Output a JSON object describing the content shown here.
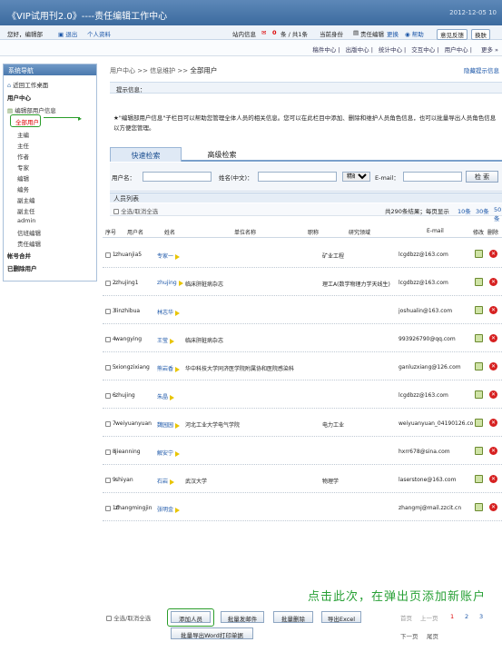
{
  "app": {
    "title": "《VIP试用刊2.0》----责任编辑工作中心",
    "date": "2012-12-05 10"
  },
  "userbar": {
    "greeting": "您好，编辑部",
    "logout": "退出",
    "profile": "个人资料",
    "messages_prefix": "站内信息",
    "messages_count": "0",
    "messages_unit": "条 / 共1条",
    "role_label": "当前身份",
    "role": "责任编辑",
    "change": "更换",
    "help": "帮助",
    "feedback": "意见反馈",
    "switch": "换肤"
  },
  "nav": {
    "items": [
      "稿件中心",
      "出版中心",
      "统计中心",
      "交互中心",
      "用户中心",
      "更多"
    ]
  },
  "sidebar": {
    "header": "系统导航",
    "desktop": "近回工作桌面",
    "user_center": "用户中心",
    "edit_dept_info": "编辑部用户信息",
    "all_users": "全部用户",
    "items": [
      "主编",
      "主任",
      "作者",
      "专家",
      "编辑",
      "编务",
      "副主编",
      "副主任",
      "admin",
      "信班编辑",
      "责任编辑"
    ],
    "account_merge": "帐号合并",
    "deleted_users": "已删除用户"
  },
  "main": {
    "breadcrumb_prefix": "用户中心 >> 信息维护 >> ",
    "breadcrumb_current": "全部用户",
    "hide_tips": "隐藏提示信息",
    "prompt": "提示信息：",
    "help_text": "★\"编辑部用户信息\"子栏目可以帮助您管理全体人员的相关信息。您可以在此栏目中添加、删除和维护人员角色信息，也可以批量导出人员角色信息以方便您管理。"
  },
  "tabs": {
    "quick": "快速检索",
    "advanced": "高级检索"
  },
  "search": {
    "user_label": "用户名：",
    "name_label": "姓名(中文)：",
    "match": "精确",
    "email_label": "E-mail：",
    "button": "检 索"
  },
  "list": {
    "header": "人员列表",
    "select_all": "全选/取消全选",
    "summary_prefix": "共290条结果；每页显示",
    "per_page": [
      "10条",
      "30条",
      "50条"
    ]
  },
  "table": {
    "columns": [
      "序号",
      "用户名",
      "姓名",
      "单位名称",
      "职称",
      "研究领域",
      "E-mail",
      "修改",
      "删除"
    ],
    "rows": [
      {
        "no": "1",
        "user": "zhuanjia5",
        "name": "专家一",
        "unit": "",
        "title": "",
        "field": "矿业工程",
        "email": "lcgdbzz@163.com"
      },
      {
        "no": "2",
        "user": "zhujing1",
        "name": "zhujing",
        "unit": "临床肝脏病杂志",
        "title": "",
        "field": "理工A(数学物理力学天线生)",
        "email": "lcgdbzz@163.com"
      },
      {
        "no": "3",
        "user": "linzhibua",
        "name": "林志华",
        "unit": "",
        "title": "",
        "field": "",
        "email": "joshualin@163.com"
      },
      {
        "no": "4",
        "user": "wangying",
        "name": "王莹",
        "unit": "临床肝脏病杂志",
        "title": "",
        "field": "",
        "email": "993926790@qq.com"
      },
      {
        "no": "5",
        "user": "xiongzixiang",
        "name": "熊岩香",
        "unit": "华中科技大学同济医学院附属协和医院感染科",
        "title": "",
        "field": "",
        "email": "ganluzxiang@126.com"
      },
      {
        "no": "6",
        "user": "zhujing",
        "name": "朱晶",
        "unit": "",
        "title": "",
        "field": "",
        "email": "lcgdbzz@163.com"
      },
      {
        "no": "7",
        "user": "weiyuanyuan",
        "name": "魏园园",
        "unit": "河北工业大学电气学院",
        "title": "",
        "field": "电力工业",
        "email": "weiyuanyuan_04190126.com"
      },
      {
        "no": "8",
        "user": "jieanning",
        "name": "解安宁",
        "unit": "",
        "title": "",
        "field": "",
        "email": "hxrr678@sina.com"
      },
      {
        "no": "9",
        "user": "shiyan",
        "name": "石岩",
        "unit": "武汉大学",
        "title": "",
        "field": "物理学",
        "email": "laserstone@163.com"
      },
      {
        "no": "10",
        "user": "zhangmingjin",
        "name": "张明金",
        "unit": "",
        "title": "",
        "field": "",
        "email": "zhangmj@mail.zzcit.cn"
      }
    ]
  },
  "footer": {
    "select_all": "全选/取消全选",
    "add": "添加人员",
    "mail": "批量发邮件",
    "delete": "批量删除",
    "export": "导出Excel",
    "export_word": "批量导出Word打印单据",
    "first": "首页",
    "prev": "上一页",
    "pages": [
      "1",
      "2",
      "3"
    ],
    "next": "下一页",
    "last": "尾页"
  },
  "annotation": "点击此次，在弹出页添加新账户",
  "colors": {
    "accent": "#1b56a8",
    "annotation": "#27a035",
    "highlight_border": "#2a9d2a",
    "topbar": "#3b6a9e"
  }
}
